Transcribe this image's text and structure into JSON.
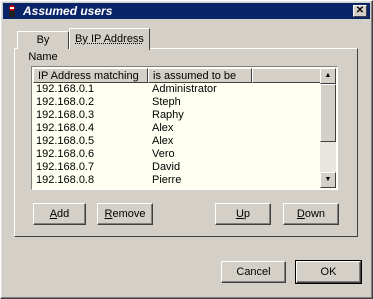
{
  "window": {
    "title": "Assumed users",
    "close_glyph": "✕"
  },
  "tabs": [
    {
      "label": "By Name",
      "active": false
    },
    {
      "label": "By IP Address",
      "active": true
    }
  ],
  "list": {
    "columns": [
      "IP Address matching",
      "is assumed to be",
      ""
    ],
    "rows": [
      {
        "ip": "192.168.0.1",
        "user": "Administrator"
      },
      {
        "ip": "192.168.0.2",
        "user": "Steph"
      },
      {
        "ip": "192.168.0.3",
        "user": "Raphy"
      },
      {
        "ip": "192.168.0.4",
        "user": "Alex"
      },
      {
        "ip": "192.168.0.5",
        "user": "Alex"
      },
      {
        "ip": "192.168.0.6",
        "user": "Vero"
      },
      {
        "ip": "192.168.0.7",
        "user": "David"
      },
      {
        "ip": "192.168.0.8",
        "user": "Pierre"
      }
    ]
  },
  "buttons": {
    "add": {
      "first": "A",
      "rest": "dd"
    },
    "remove": {
      "first": "R",
      "rest": "emove"
    },
    "up": {
      "first": "U",
      "rest": "p"
    },
    "down": {
      "first": "D",
      "rest": "own"
    },
    "cancel": "Cancel",
    "ok": "OK"
  },
  "icons": {
    "scroll_up": "▲",
    "scroll_down": "▼",
    "app_icon": "mascot-icon"
  },
  "colors": {
    "titlebar": "#0a246a",
    "face": "#d4d0c8",
    "list_bg": "#fffff2"
  }
}
